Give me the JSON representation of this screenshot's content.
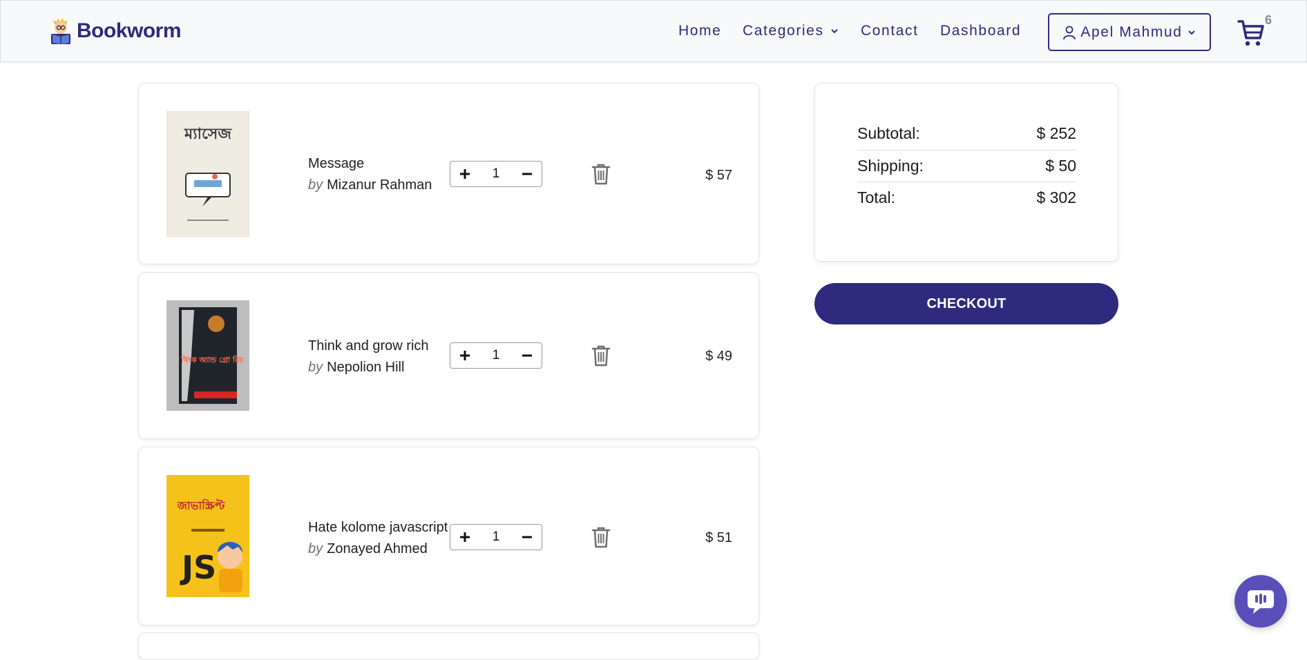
{
  "brand": {
    "name": "Bookworm",
    "logo_icon": "reading-boy-logo"
  },
  "nav": {
    "home": "Home",
    "categories": "Categories",
    "contact": "Contact",
    "dashboard": "Dashboard",
    "user_name": "Apel Mahmud",
    "cart_count": "6"
  },
  "cart": {
    "by_label": "by",
    "items": [
      {
        "title": "Message",
        "author": "Mizanur Rahman",
        "quantity": "1",
        "price": "$ 57",
        "cover_text": "ম্যাসেজ"
      },
      {
        "title": "Think and grow rich",
        "author": "Nepolion Hill",
        "quantity": "1",
        "price": "$ 49",
        "cover_text": "থিংক অ্যান্ড গ্রো রিচ"
      },
      {
        "title": "Hate kolome javascript",
        "author": "Zonayed Ahmed",
        "quantity": "1",
        "price": "$ 51",
        "cover_text": "জাভাস্ক্রিপ্ট"
      }
    ]
  },
  "summary": {
    "subtotal_label": "Subtotal:",
    "subtotal_value": "$ 252",
    "shipping_label": "Shipping:",
    "shipping_value": "$ 50",
    "total_label": "Total:",
    "total_value": "$ 302",
    "checkout_label": "CHECKOUT"
  },
  "colors": {
    "primary": "#2e2a7d",
    "chat": "#5a4fb8"
  }
}
